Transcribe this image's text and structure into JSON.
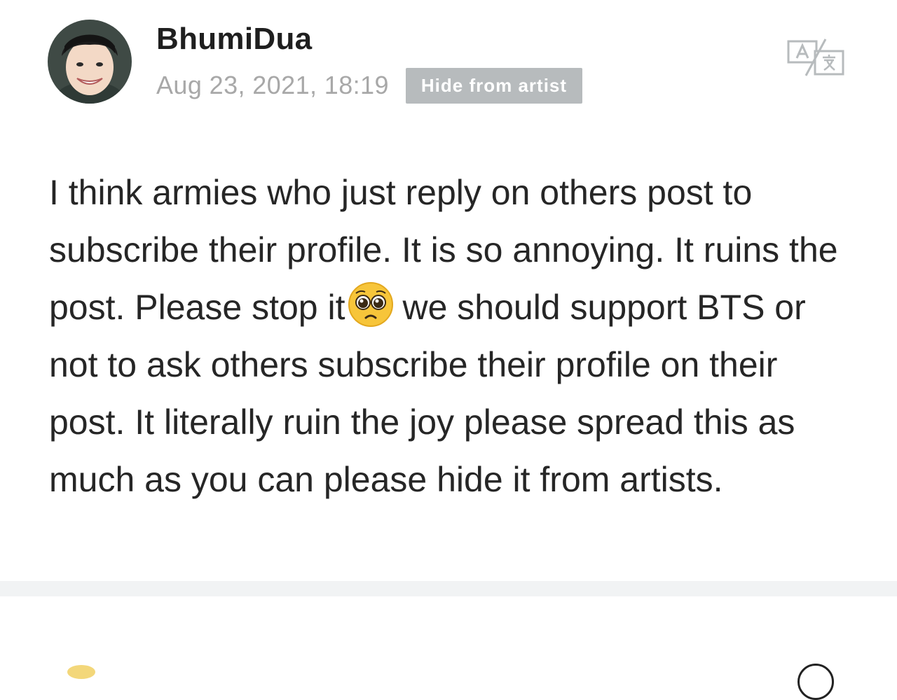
{
  "post": {
    "username": "BhumiDua",
    "timestamp": "Aug 23, 2021, 18:19",
    "hide_label": "Hide from artist",
    "body_segments": [
      "I think armies who just reply on others post to subscribe their profile. It is so annoying. It ruins the post. Please stop it",
      "we should support BTS or not to ask others subscribe their profile on their post. It literally ruin the joy please spread this as much as you can please hide it from artists."
    ],
    "emoji": "pleading-face-emoji"
  },
  "icons": {
    "translate": "translate-icon",
    "avatar": "profile-avatar"
  },
  "colors": {
    "badge_bg": "#b7bbbd",
    "timestamp": "#a8a8a8",
    "text": "#262626",
    "divider": "#f1f3f4"
  }
}
